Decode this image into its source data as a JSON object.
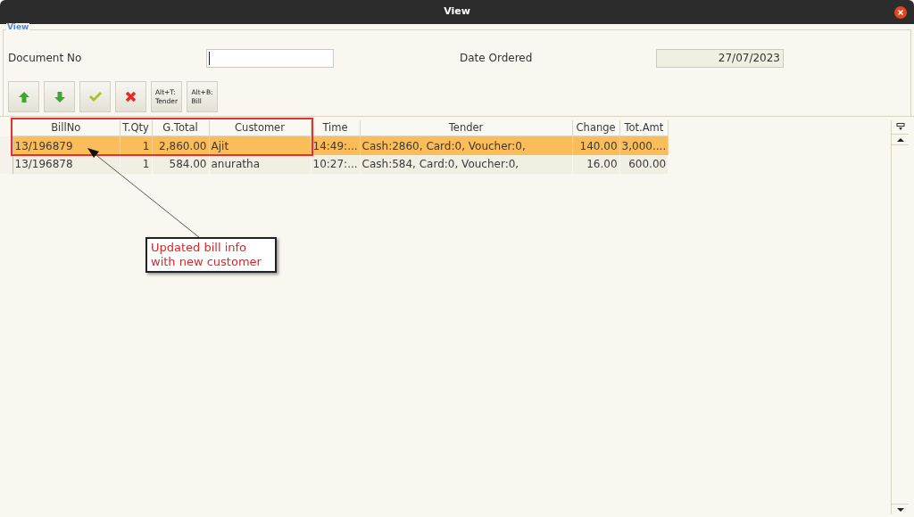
{
  "window": {
    "title": "View"
  },
  "group_label": "View",
  "form": {
    "document_no": {
      "label": "Document No",
      "focused": true
    },
    "date_ordered": {
      "label": "Date Ordered",
      "value": "27/07/2023"
    }
  },
  "toolbar": [
    {
      "kind": "up"
    },
    {
      "kind": "down"
    },
    {
      "kind": "ok"
    },
    {
      "kind": "cancel"
    },
    {
      "kind": "text",
      "label": "Alt+T:\nTender"
    },
    {
      "kind": "text",
      "label": "Alt+B:\nBill"
    }
  ],
  "table": {
    "columns": [
      {
        "label": "BillNo",
        "kind": "text"
      },
      {
        "label": "T.Qty",
        "kind": "number"
      },
      {
        "label": "G.Total",
        "kind": "number"
      },
      {
        "label": "Customer",
        "kind": "text"
      },
      {
        "label": "Time",
        "kind": "text"
      },
      {
        "label": "Tender",
        "kind": "text"
      },
      {
        "label": "Change",
        "kind": "number"
      },
      {
        "label": "Tot.Amt",
        "kind": "number"
      }
    ],
    "rows": [
      {
        "selected": true,
        "cells": [
          "13/196879",
          "1",
          "2,860.00",
          "Ajit",
          "14:49:...",
          "Cash:2860, Card:0, Voucher:0,",
          "140.00",
          "3,000...."
        ]
      },
      {
        "selected": false,
        "cells": [
          "13/196878",
          "1",
          "584.00",
          "anuratha",
          "10:27:...",
          "Cash:584, Card:0, Voucher:0,",
          "16.00",
          "600.00"
        ]
      }
    ]
  },
  "annotation": {
    "text": "Updated bill info\nwith new customer"
  }
}
